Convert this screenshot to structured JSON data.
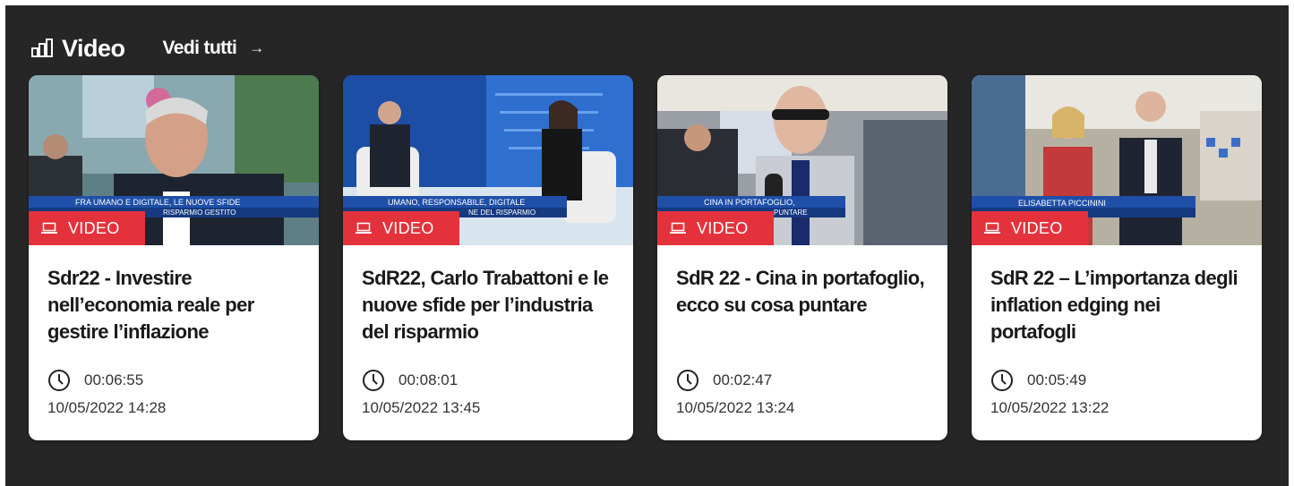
{
  "section": {
    "title": "Video",
    "icon": "bar-chart-icon",
    "see_all_label": "Vedi tutti",
    "see_all_icon": "arrow-right-icon"
  },
  "colors": {
    "background": "#262626",
    "card": "#ffffff",
    "badge": "#e4323c",
    "ticker": "#1f4fa8"
  },
  "cards": [
    {
      "badge": "VIDEO",
      "badge_icon": "laptop-icon",
      "title": "Sdr22 - Investire nell’economia reale per gestire l’inflazione",
      "duration": "00:06:55",
      "date": "10/05/2022 14:28",
      "thumb_lines": [
        "FRA UMANO E DIGITALE, LE NUOVE SFIDE",
        "RISPARMIO GESTITO"
      ]
    },
    {
      "badge": "VIDEO",
      "badge_icon": "laptop-icon",
      "title": "SdR22, Carlo Trabattoni e le nuove sfide per l’industria del risparmio",
      "duration": "00:08:01",
      "date": "10/05/2022 13:45",
      "thumb_lines": [
        "UMANO, RESPONSABILE, DIGITALE",
        "NE DEL RISPARMIO"
      ]
    },
    {
      "badge": "VIDEO",
      "badge_icon": "laptop-icon",
      "title": "SdR 22 - Cina in portafoglio, ecco su cosa puntare",
      "duration": "00:02:47",
      "date": "10/05/2022 13:24",
      "thumb_lines": [
        "CINA IN PORTAFOGLIO,",
        "PUNTARE"
      ]
    },
    {
      "badge": "VIDEO",
      "badge_icon": "laptop-icon",
      "title": "SdR 22 – L’importanza degli inflation edging nei portafogli",
      "duration": "00:05:49",
      "date": "10/05/2022 13:22",
      "thumb_lines": [
        "ELISABETTA PICCININI",
        ""
      ]
    }
  ]
}
